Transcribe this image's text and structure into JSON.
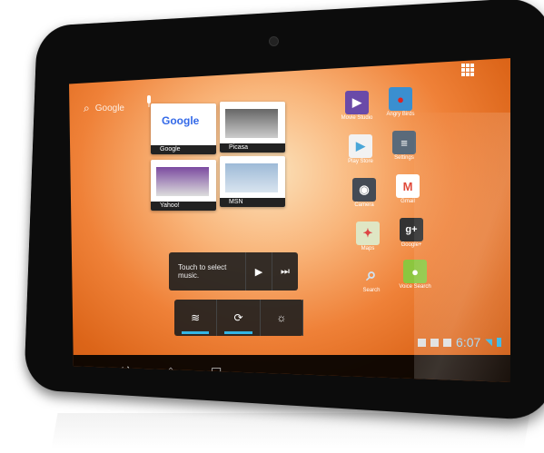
{
  "search": {
    "logo_text": "Google"
  },
  "recents": [
    {
      "label": "Google"
    },
    {
      "label": "Picasa"
    },
    {
      "label": "Yahoo!"
    },
    {
      "label": "MSN"
    }
  ],
  "thumb_google_text": "Google",
  "music": {
    "prompt": "Touch to select music.",
    "play": "▶",
    "next": "⏭"
  },
  "power": {
    "wifi": "≋",
    "sync": "⟳",
    "brightness": "☼"
  },
  "apps": [
    {
      "name": "Movie Studio",
      "icon": "clapper-icon",
      "color": "#6a4aa8",
      "glyph": "🎬"
    },
    {
      "name": "Angry Birds",
      "icon": "bird-icon",
      "color": "#3a8fd0",
      "glyph": "●"
    },
    {
      "name": "Play Store",
      "icon": "shopping-bag-icon",
      "color": "#f2f2f2",
      "glyph": "▶"
    },
    {
      "name": "Settings",
      "icon": "settings-icon",
      "color": "#5a6a7a",
      "glyph": "≡"
    },
    {
      "name": "Camera",
      "icon": "camera-icon",
      "color": "#444b55",
      "glyph": "◉"
    },
    {
      "name": "Gmail",
      "icon": "mail-icon",
      "color": "#e04a3b",
      "glyph": "M"
    },
    {
      "name": "Maps",
      "icon": "map-icon",
      "color": "#dfe6c4",
      "glyph": "✦"
    },
    {
      "name": "Google+",
      "icon": "google-plus-icon",
      "color": "#333333",
      "glyph": "g+"
    },
    {
      "name": "Search",
      "icon": "magnifier-icon",
      "color": "#cfe3f3",
      "glyph": "⌕"
    },
    {
      "name": "Voice Search",
      "icon": "android-mic-icon",
      "color": "#8cc63f",
      "glyph": "🎙"
    }
  ],
  "status": {
    "time": "6:07"
  },
  "nav": {
    "back": "↩",
    "home": "⌂",
    "recent": "▭"
  }
}
